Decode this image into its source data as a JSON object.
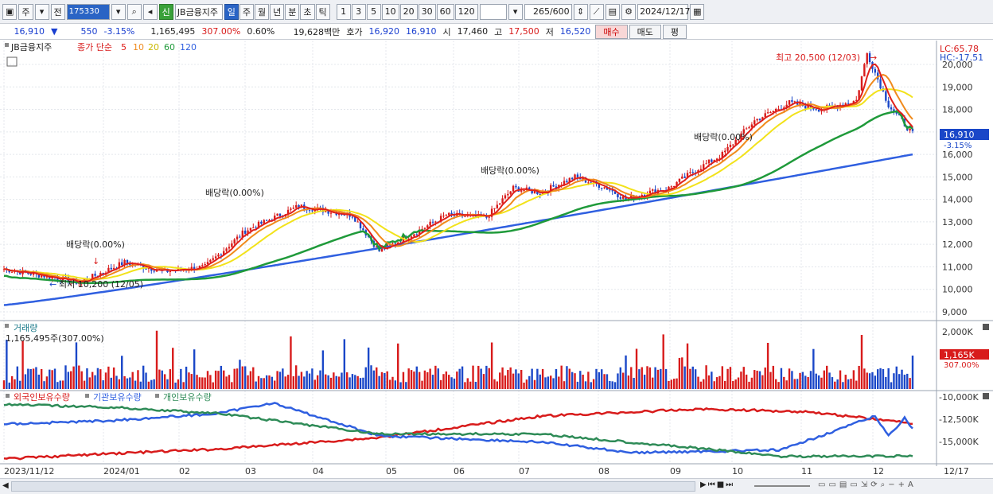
{
  "toolbar": {
    "type_label": "주",
    "prev_label": "전",
    "code": "175330",
    "credit_badge": "신",
    "stock_name": "JB금융지주",
    "periods": [
      "일",
      "주",
      "월",
      "년",
      "분",
      "초",
      "틱"
    ],
    "intervals": [
      "1",
      "3",
      "5",
      "10",
      "20",
      "30",
      "60",
      "120"
    ],
    "count": "265",
    "count_max": "/600",
    "date": "2024/12/17"
  },
  "quote": {
    "price": "16,910",
    "change": "550",
    "change_pct": "-3.15%",
    "volume": "1,165,495",
    "volume_pct": "307.00%",
    "turnover_pct": "0.60%",
    "amount": "19,628백만",
    "bid_label": "호가",
    "ask": "16,920",
    "bid": "16,910",
    "open_label": "시",
    "open": "17,460",
    "high_label": "고",
    "high": "17,500",
    "low_label": "저",
    "low": "16,520",
    "buy_label": "매수",
    "sell_label": "매도",
    "avg_label": "평"
  },
  "legend": {
    "name": "JB금융지주",
    "close_label": "종가 단순",
    "ma": [
      "5",
      "10",
      "20",
      "60",
      "120"
    ]
  },
  "annotations": {
    "max_label": "최고 20,500 (12/03)",
    "min_label": "최저 10,200 (12/05)",
    "dividend": "배당락(0.00%)",
    "lc": "LC:65.78",
    "hc": "HC:-17.51",
    "price_tag": "16,910",
    "price_pct": "-3.15%",
    "volume_title": "거래량",
    "volume_value": "1,165,495주(307.00%)",
    "volume_tag": "1,165K",
    "volume_pct": "307.00%",
    "holder_legend": [
      "외국인보유수량",
      "기관보유수량",
      "개인보유수량"
    ]
  },
  "axes": {
    "price_ticks": [
      "20,000",
      "19,000",
      "18,000",
      "17,000",
      "16,000",
      "15,000",
      "14,000",
      "13,000",
      "12,000",
      "11,000",
      "10,000",
      "9,000"
    ],
    "volume_ticks": [
      "2,000K"
    ],
    "holder_ticks": [
      "-10,000K",
      "-12,500K",
      "-15,000K"
    ],
    "x_labels": [
      "2023/11/12",
      "2024/01",
      "02",
      "03",
      "04",
      "05",
      "06",
      "07",
      "08",
      "09",
      "10",
      "11",
      "12",
      "12/17"
    ]
  },
  "chart_data": {
    "type": "line",
    "series": [
      {
        "name": "종가",
        "x": [
          "2023/11",
          "2023/12",
          "2024/01",
          "2024/02",
          "2024/03",
          "2024/04",
          "2024/05",
          "2024/06",
          "2024/07",
          "2024/08",
          "2024/09",
          "2024/10",
          "2024/11",
          "2024/12/03",
          "2024/12/17"
        ],
        "values": [
          10900,
          10400,
          10900,
          12600,
          13700,
          11700,
          13300,
          14500,
          14900,
          14000,
          14200,
          16000,
          18300,
          20500,
          16910
        ]
      },
      {
        "name": "120",
        "x": [
          "2023/11",
          "2024/03",
          "2024/06",
          "2024/09",
          "2024/12/17"
        ],
        "values": [
          9300,
          11000,
          12800,
          14100,
          16000
        ]
      }
    ],
    "ylim": [
      9000,
      20500
    ]
  },
  "colors": {
    "candle_up": "#d81b1b",
    "candle_down": "#1a47c8",
    "ma5": "#e0201b",
    "ma10": "#f08a1c",
    "ma20": "#f2e21a",
    "ma60": "#1f9a3a",
    "ma120": "#2f5fe0",
    "foreign": "#d81b1b",
    "institution": "#2f5fe0",
    "individual": "#2e8b57"
  }
}
